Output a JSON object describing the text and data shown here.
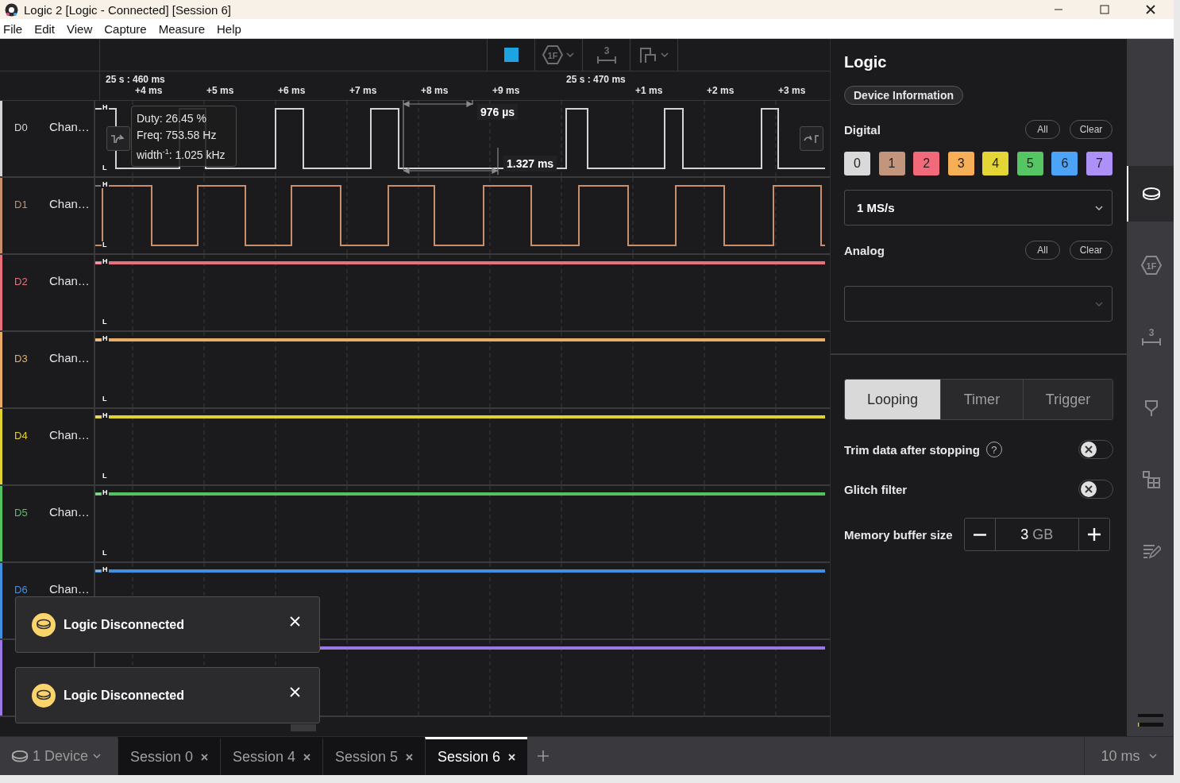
{
  "window": {
    "title": "Logic 2 [Logic - Connected] [Session 6]"
  },
  "menu": [
    "File",
    "Edit",
    "View",
    "Capture",
    "Measure",
    "Help"
  ],
  "toolbar": [
    {
      "kind": "stop",
      "dropdown": false
    },
    {
      "kind": "analyzers",
      "glyph": "1F",
      "dropdown": true
    },
    {
      "kind": "measure",
      "glyph": "3",
      "dropdown": false
    },
    {
      "kind": "markers",
      "dropdown": true
    }
  ],
  "timeline": {
    "anchors": [
      "25 s : 460 ms",
      "25 s : 470 ms"
    ],
    "ticks": [
      "+4 ms",
      "+5 ms",
      "+6 ms",
      "+7 ms",
      "+8 ms",
      "+9 ms",
      "+1 ms",
      "+2 ms",
      "+3 ms"
    ]
  },
  "channels": [
    {
      "id": "D0",
      "name": "Chan…",
      "color": "#d4d4d4",
      "high_mark": "H",
      "low_mark": "L"
    },
    {
      "id": "D1",
      "name": "Chan…",
      "color": "#c98e6c",
      "high_mark": "H",
      "low_mark": "L"
    },
    {
      "id": "D2",
      "name": "Chan…",
      "color": "#e8707c",
      "high_mark": "H",
      "low_mark": "L"
    },
    {
      "id": "D3",
      "name": "Chan…",
      "color": "#e9ad66",
      "high_mark": "H",
      "low_mark": "L"
    },
    {
      "id": "D4",
      "name": "Chan…",
      "color": "#e2d230",
      "high_mark": "H",
      "low_mark": "L"
    },
    {
      "id": "D5",
      "name": "Chan…",
      "color": "#52c262",
      "high_mark": "H",
      "low_mark": "L"
    },
    {
      "id": "D6",
      "name": "Chan…",
      "color": "#3f8fe2",
      "high_mark": "H"
    },
    {
      "color": "#9a7ae2"
    }
  ],
  "tooltip": {
    "lines": [
      "Duty: 26.45 %",
      "Freq: 753.58 Hz",
      "width$^{-1}$: 1.025 kHz"
    ]
  },
  "measurements": [
    {
      "kind": "width",
      "label": "976 µs"
    },
    {
      "kind": "period",
      "label": "1.327 ms"
    }
  ],
  "toasts": [
    {
      "message": "Logic Disconnected"
    },
    {
      "message": "Logic Disconnected"
    }
  ],
  "panel": {
    "title": "Logic",
    "device_button": "Device Information",
    "digital": {
      "label": "Digital",
      "all": "All",
      "clear": "Clear",
      "sample_rate": "1 MS/s",
      "channels": [
        {
          "label": "0",
          "color": "#d9d9d9"
        },
        {
          "label": "1",
          "color": "#c4957d"
        },
        {
          "label": "2",
          "color": "#f26a7a"
        },
        {
          "label": "3",
          "color": "#f7af57"
        },
        {
          "label": "4",
          "color": "#e4d637"
        },
        {
          "label": "5",
          "color": "#56c563"
        },
        {
          "label": "6",
          "color": "#4da3f6"
        },
        {
          "label": "7",
          "color": "#ad90f8"
        }
      ]
    },
    "analog": {
      "label": "Analog",
      "all": "All",
      "clear": "Clear"
    },
    "modes": [
      {
        "label": "Looping",
        "selected": true
      },
      {
        "label": "Timer",
        "selected": false
      },
      {
        "label": "Trigger",
        "selected": false
      }
    ],
    "settings": [
      {
        "kind": "toggle",
        "label": "Trim data after stopping",
        "help": "?",
        "on": false
      },
      {
        "kind": "toggle",
        "label": "Glitch filter",
        "on": false
      },
      {
        "kind": "stepper",
        "label": "Memory buffer size",
        "value": "3",
        "unit": "GB"
      }
    ]
  },
  "sidebar": [
    {
      "kind": "device",
      "selected": true
    },
    {
      "kind": "analyzers",
      "glyph": "1F",
      "selected": false
    },
    {
      "kind": "measure",
      "glyph": "3",
      "selected": false
    },
    {
      "kind": "pin",
      "selected": false
    },
    {
      "kind": "extensions",
      "selected": false
    },
    {
      "kind": "notes",
      "selected": false
    }
  ],
  "bottom_bar": {
    "device": "1 Device",
    "tabs": [
      {
        "label": "Session 0",
        "selected": false
      },
      {
        "label": "Session 4",
        "selected": false
      },
      {
        "label": "Session 5",
        "selected": false
      },
      {
        "label": "Session 6",
        "selected": true
      }
    ],
    "zoom": "10 ms"
  }
}
